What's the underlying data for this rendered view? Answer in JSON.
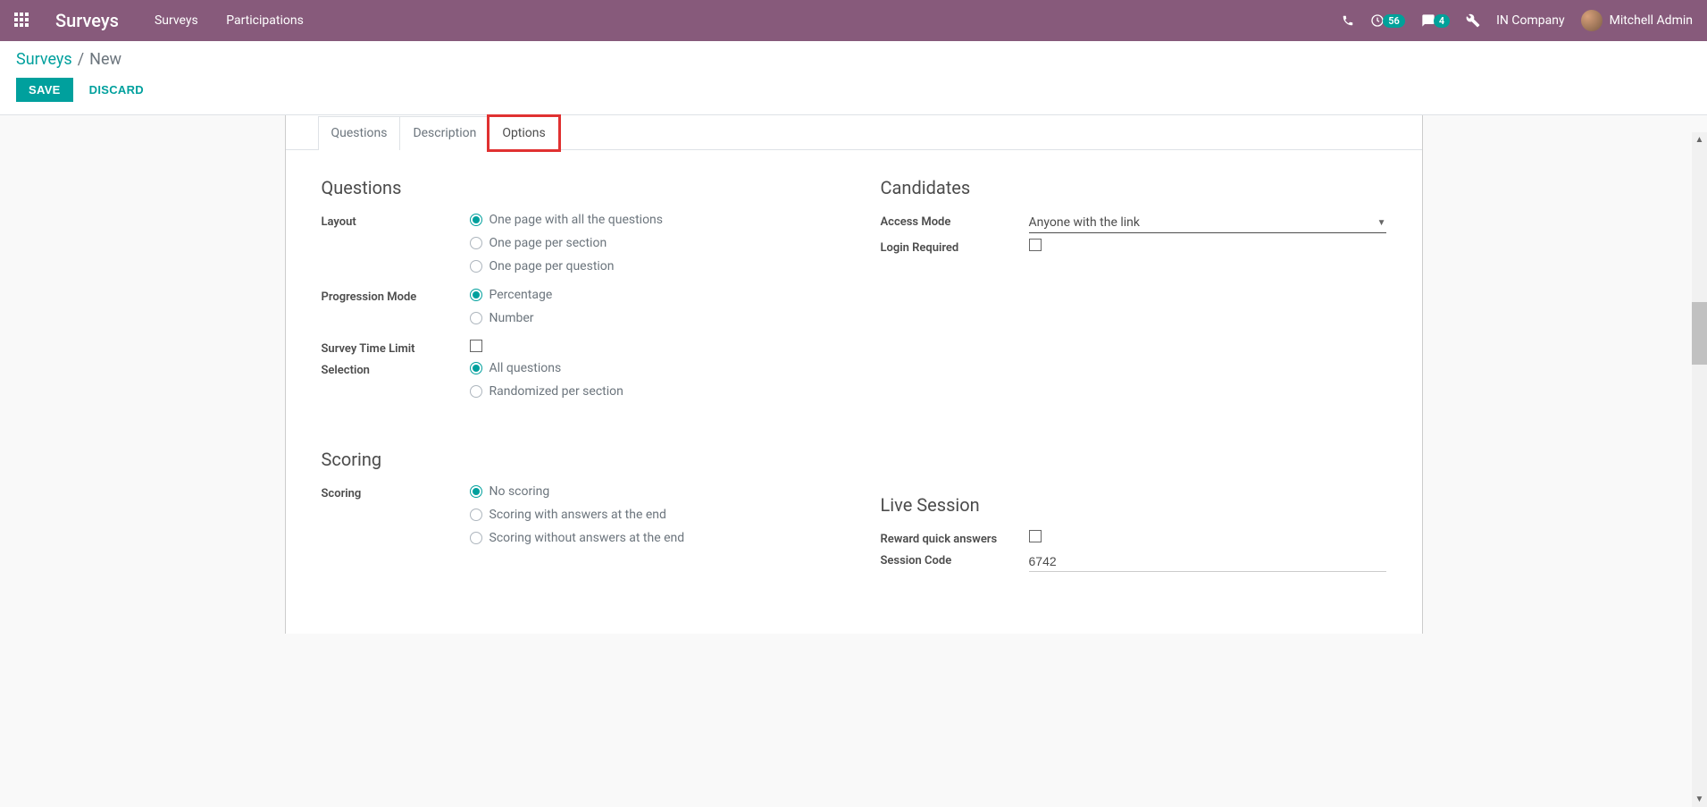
{
  "header": {
    "brand": "Surveys",
    "nav": [
      "Surveys",
      "Participations"
    ],
    "badges": {
      "activities": "56",
      "messages": "4"
    },
    "company": "IN Company",
    "user": "Mitchell Admin"
  },
  "breadcrumb": {
    "root": "Surveys",
    "sep": "/",
    "current": "New"
  },
  "actions": {
    "save": "SAVE",
    "discard": "DISCARD"
  },
  "tabs": [
    {
      "label": "Questions",
      "active": false
    },
    {
      "label": "Description",
      "active": false
    },
    {
      "label": "Options",
      "active": true,
      "highlight": true
    }
  ],
  "sections": {
    "questions": {
      "title": "Questions",
      "layout": {
        "label": "Layout",
        "options": [
          {
            "text": "One page with all the questions",
            "checked": true
          },
          {
            "text": "One page per section",
            "checked": false
          },
          {
            "text": "One page per question",
            "checked": false
          }
        ]
      },
      "progression": {
        "label": "Progression Mode",
        "options": [
          {
            "text": "Percentage",
            "checked": true
          },
          {
            "text": "Number",
            "checked": false
          }
        ]
      },
      "time_limit": {
        "label": "Survey Time Limit"
      },
      "selection": {
        "label": "Selection",
        "options": [
          {
            "text": "All questions",
            "checked": true
          },
          {
            "text": "Randomized per section",
            "checked": false
          }
        ]
      }
    },
    "candidates": {
      "title": "Candidates",
      "access_mode": {
        "label": "Access Mode",
        "value": "Anyone with the link"
      },
      "login_required": {
        "label": "Login Required"
      }
    },
    "scoring": {
      "title": "Scoring",
      "label": "Scoring",
      "options": [
        {
          "text": "No scoring",
          "checked": true
        },
        {
          "text": "Scoring with answers at the end",
          "checked": false
        },
        {
          "text": "Scoring without answers at the end",
          "checked": false
        }
      ]
    },
    "live": {
      "title": "Live Session",
      "reward": {
        "label": "Reward quick answers"
      },
      "session_code": {
        "label": "Session Code",
        "value": "6742"
      }
    }
  }
}
